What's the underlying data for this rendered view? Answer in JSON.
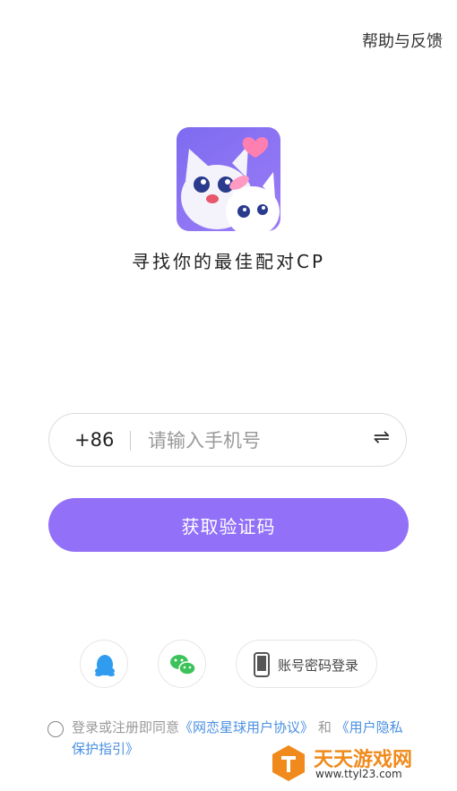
{
  "header": {
    "help_label": "帮助与反馈"
  },
  "app": {
    "slogan": "寻找你的最佳配对CP"
  },
  "login": {
    "country_code": "+86",
    "phone_placeholder": "请输入手机号",
    "swap_glyph": "⇌",
    "get_code_label": "获取验证码"
  },
  "social": {
    "qq_icon": "qq-penguin-icon",
    "wechat_icon": "wechat-icon",
    "account_label": "账号密码登录"
  },
  "agreement": {
    "prefix": "登录或注册即同意",
    "user_agreement": "《网恋星球用户协议》",
    "and": "和",
    "privacy": "《用户隐私保护指引》"
  },
  "watermark": {
    "title": "天天游戏网",
    "url": "www.ttyl23.com"
  },
  "colors": {
    "primary": "#9270f8",
    "link": "#4a90e2",
    "watermark": "#f08a1c"
  }
}
